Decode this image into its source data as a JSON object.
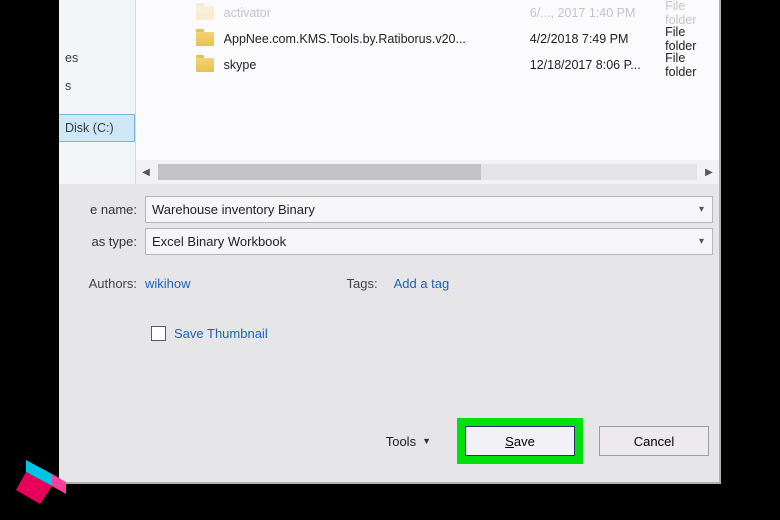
{
  "sidebar": {
    "items": [
      {
        "label": "es"
      },
      {
        "label": "s"
      },
      {
        "label": "Disk (C:)"
      }
    ]
  },
  "filelist": {
    "rows": [
      {
        "name": "activator",
        "date": "6/..., 2017 1:40 PM",
        "type": "File folder"
      },
      {
        "name": "AppNee.com.KMS.Tools.by.Ratiborus.v20...",
        "date": "4/2/2018 7:49 PM",
        "type": "File folder"
      },
      {
        "name": "skype",
        "date": "12/18/2017 8:06 P...",
        "type": "File folder"
      }
    ]
  },
  "form": {
    "name_label": "e name:",
    "name_value": "Warehouse inventory Binary",
    "type_label": "as type:",
    "type_value": "Excel Binary Workbook"
  },
  "meta": {
    "authors_label": "Authors:",
    "authors_value": "wikihow",
    "tags_label": "Tags:",
    "tags_value": "Add a tag"
  },
  "thumbnail_label": "Save Thumbnail",
  "buttons": {
    "tools": "Tools",
    "save": "Save",
    "cancel": "Cancel"
  },
  "colors": {
    "highlight": "#00e10b",
    "link": "#1a62b8"
  }
}
